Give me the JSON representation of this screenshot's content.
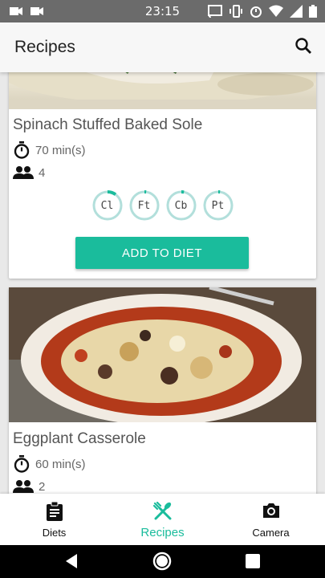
{
  "status": {
    "time": "23:15"
  },
  "appbar": {
    "title": "Recipes",
    "search_icon": "search-icon"
  },
  "colors": {
    "accent": "#1abc9c",
    "badge_bg": "#b2dfdb",
    "statusbar": "#6b6b6b"
  },
  "recipes": [
    {
      "title": "Spinach Stuffed Baked Sole",
      "time": "70 min(s)",
      "servings": "4",
      "nutrients": [
        {
          "label": "Cl",
          "fill": 0.1
        },
        {
          "label": "Ft",
          "fill": 0.02
        },
        {
          "label": "Cb",
          "fill": 0.03
        },
        {
          "label": "Pt",
          "fill": 0.02
        }
      ],
      "button": "ADD TO DIET"
    },
    {
      "title": "Eggplant Casserole",
      "time": "60 min(s)",
      "servings": "2"
    }
  ],
  "bottom_nav": [
    {
      "label": "Diets",
      "icon": "clipboard-icon",
      "active": false
    },
    {
      "label": "Recipes",
      "icon": "fork-knife-icon",
      "active": true
    },
    {
      "label": "Camera",
      "icon": "camera-icon",
      "active": false
    }
  ]
}
